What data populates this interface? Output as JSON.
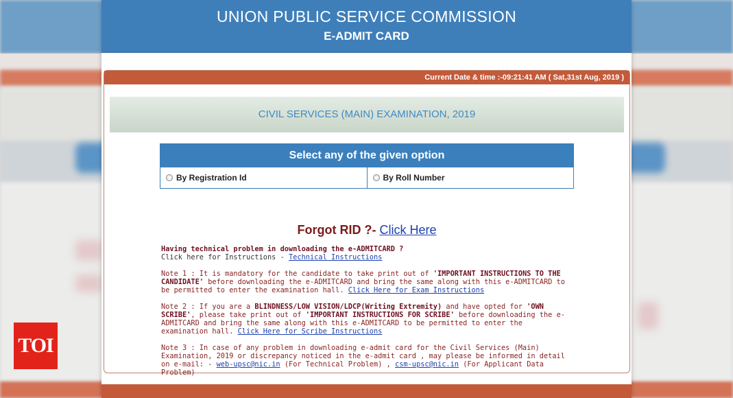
{
  "header": {
    "title": "UNION PUBLIC SERVICE COMMISSION",
    "subtitle": "E-ADMIT CARD"
  },
  "datebar": {
    "text": "Current Date & time :-09:21:41 AM ( Sat,31st Aug, 2019 )"
  },
  "exam": {
    "title": "CIVIL SERVICES (MAIN) EXAMINATION, 2019"
  },
  "options": {
    "heading": "Select any of the given option",
    "items": [
      {
        "label": "By Registration Id"
      },
      {
        "label": "By Roll Number"
      }
    ]
  },
  "forgot": {
    "label": "Forgot RID ?-",
    "link": "Click Here"
  },
  "notes": {
    "tech_heading": "Having technical problem in downloading the e-ADMITCARD ?",
    "tech_text": "Click here for Instructions -",
    "tech_link": "Technical Instructions",
    "note1_a": "Note 1 : It is mandatory for the candidate to take print out of",
    "note1_b": "'IMPORTANT INSTRUCTIONS TO THE CANDIDATE'",
    "note1_c": "before downloading the e-ADMITCARD and bring the same along with this e-ADMITCARD to be permitted to enter the examination hall.",
    "note1_link": "Click Here for Exam Instructions",
    "note2_a": "Note 2 : If you are a",
    "note2_b": "BLINDNESS/LOW VISION/LDCP(Writing Extremity)",
    "note2_c": "and have opted for",
    "note2_d": "'OWN SCRIBE'",
    "note2_e": ", please take print out of",
    "note2_f": "'IMPORTANT INSTRUCTIONS FOR SCRIBE'",
    "note2_g": "before downloading the e-ADMITCARD and bring the same along with this e-ADMITCARD to be permitted to enter the examination hall.",
    "note2_link": "Click Here for Scribe Instructions",
    "note3_a": "Note 3 : In case of any problem in downloading e-admit card for the Civil Services (Main) Examination, 2019 or discrepancy noticed in the e-admit card , may please be informed in detail on e-mail: -",
    "note3_email1": "web-upsc@nic.in",
    "note3_b": "(For Technical Problem) ,",
    "note3_email2": "csm-upsc@nic.in",
    "note3_c": "(For Applicant Data Problem)"
  },
  "watermark": {
    "logo_text": "TOI"
  },
  "colors": {
    "header_blue": "#3e7fba",
    "date_bar": "#c35a3a",
    "exam_text": "#3f8ac3",
    "note_text": "#8b2424",
    "link": "#1c3fb0",
    "logo_red": "#e2231a"
  }
}
